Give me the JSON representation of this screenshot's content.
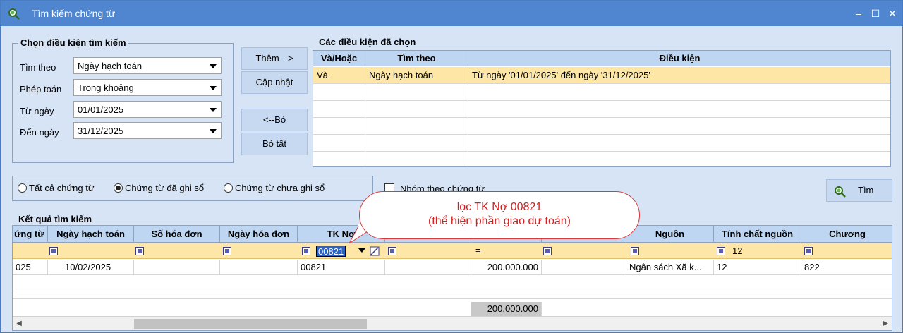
{
  "window": {
    "title": "Tìm kiếm chứng từ",
    "minimize_glyph": "–",
    "maximize_glyph": "☐",
    "close_glyph": "✕"
  },
  "search_conditions": {
    "legend": "Chọn điều kiện tìm kiếm",
    "search_by_label": "Tìm theo",
    "search_by_value": "Ngày hạch toán",
    "operator_label": "Phép toán",
    "operator_value": "Trong khoảng",
    "from_date_label": "Từ ngày",
    "from_date_value": "01/01/2025",
    "to_date_label": "Đến ngày",
    "to_date_value": "31/12/2025"
  },
  "buttons": {
    "add": "Thêm -->",
    "update": "Cập nhật",
    "remove": "<--Bỏ",
    "remove_all": "Bỏ tất",
    "search": "Tìm"
  },
  "selected_conditions": {
    "legend": "Các điều kiện đã chọn",
    "headers": [
      "Và/Hoặc",
      "Tìm theo",
      "Điều kiện"
    ],
    "rows": [
      {
        "andor": "Và",
        "by": "Ngày hạch toán",
        "condition": "Từ ngày '01/01/2025' đến ngày '31/12/2025'"
      }
    ]
  },
  "filter_options": {
    "all_vouchers": "Tất cả chứng từ",
    "posted_vouchers": "Chứng từ đã ghi sổ",
    "unposted_vouchers": "Chứng từ chưa ghi sổ",
    "selected": "posted_vouchers",
    "group_by_voucher": "Nhóm theo chứng từ",
    "group_by_voucher_checked": false
  },
  "results": {
    "legend": "Kết quả tìm kiếm",
    "headers": [
      "ứng từ",
      "Ngày hạch toán",
      "Số hóa đơn",
      "Ngày hóa đơn",
      "TK Nợ",
      "",
      "",
      "",
      "Nguồn",
      "Tính chất nguồn",
      "Chương"
    ],
    "filter_row": {
      "tk_no": "00821",
      "amount_op": "=",
      "tinh_chat_nguon": "12"
    },
    "rows": [
      {
        "chung_tu": "025",
        "ngay_hach_toan": "10/02/2025",
        "so_hoa_don": "",
        "ngay_hoa_don": "",
        "tk_no": "00821",
        "col6": "",
        "amount": "200.000.000",
        "col8": "",
        "nguon": "Ngân sách Xã k...",
        "tinh_chat_nguon": "12",
        "chuong": "822"
      }
    ],
    "total_amount": "200.000.000"
  },
  "annotation": {
    "line1": "lọc TK Nợ 00821",
    "line2": "(thể hiện phần giao dự toán)"
  },
  "colors": {
    "titlebar": "#4f86cf",
    "background": "#d6e4f5",
    "header": "#bfd6f2",
    "selected_row": "#fde6a6",
    "callout_text": "#d42020"
  }
}
